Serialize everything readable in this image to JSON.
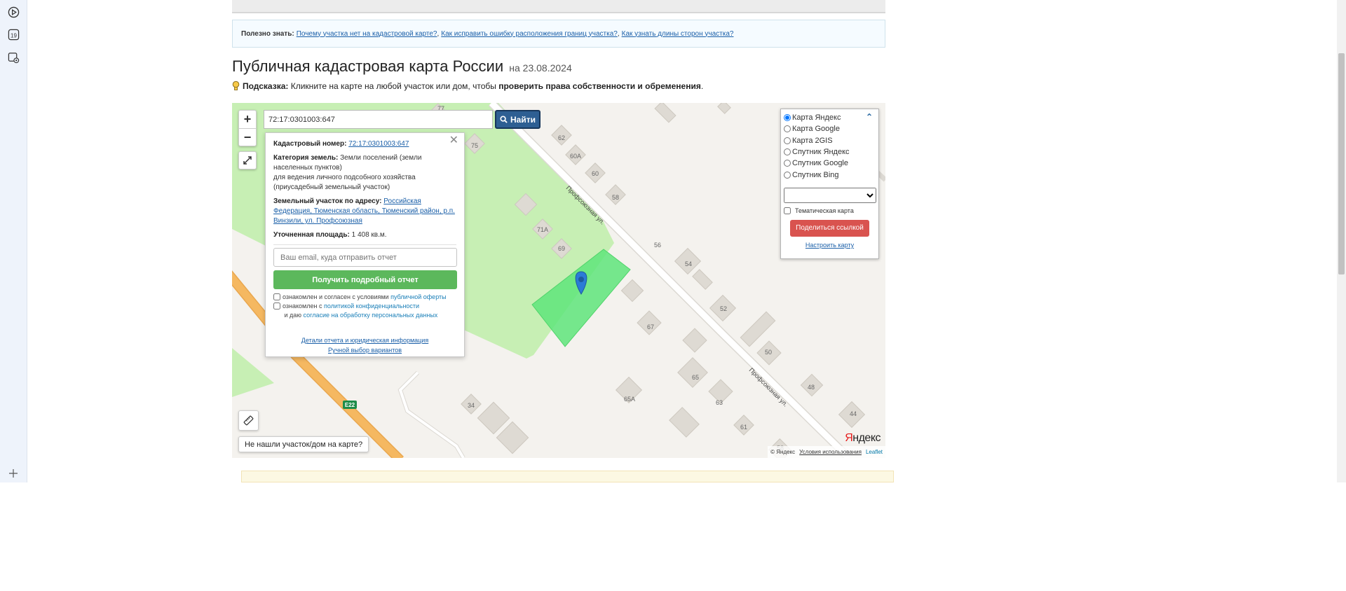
{
  "rail": {
    "icons": [
      "play-circle-icon",
      "calendar-icon",
      "screenshot-icon",
      "add-icon"
    ],
    "calendar_day": "19"
  },
  "info": {
    "lead": "Полезно знать:",
    "links": [
      "Почему участка нет на кадастровой карте?",
      "Как исправить ошибку расположения границ участка?",
      "Как узнать длины сторон участка?"
    ],
    "sep": ","
  },
  "title": {
    "main": "Публичная кадастровая карта России",
    "date": "на 23.08.2024"
  },
  "hint": {
    "label": "Подсказка:",
    "text": " Кликните на карте на любой участок или дом, чтобы ",
    "bold": "проверить права собственности и обременения",
    "end": "."
  },
  "search": {
    "value": "72:17:0301003:647",
    "button": "Найти"
  },
  "zoom": {
    "in": "+",
    "out": "−"
  },
  "popup": {
    "cadastral_label": "Кадастровый номер:",
    "cadastral_value": "72:17:0301003:647",
    "category_label": "Категория земель:",
    "category_value": "Земли поселений (земли населенных пунктов)",
    "category_use": "для ведения личного подсобного хозяйства (приусадебный земельный участок)",
    "address_label": "Земельный участок по адресу:",
    "address_value": "Российская Федерация, Тюменская область, Тюменский район, р.п. Винзили, ул. Профсоюзная",
    "area_label": "Уточненная площадь:",
    "area_value": "1 408 кв.м.",
    "email_placeholder": "Ваш email, куда отправить отчет",
    "report_button": "Получить подробный отчет",
    "consent1_text": "ознакомлен и согласен с условиями ",
    "consent1_link": "публичной оферты",
    "consent2_text": "ознакомлен с ",
    "consent2_link": "политикой конфиденциальности",
    "consent2_mid": " и даю ",
    "consent2_link2": "согласие на обработку персональных данных",
    "details_link": "Детали отчета и юридическая информация",
    "manual_link": "Ручной выбор вариантов"
  },
  "layers": {
    "options": [
      "Карта Яндекс",
      "Карта Google",
      "Карта 2GIS",
      "Спутник Яндекс",
      "Спутник Google",
      "Спутник Bing"
    ],
    "selected": "Карта Яндекс",
    "thematic": "Тематическая карта",
    "share": "Поделиться ссылкой",
    "configure": "Настроить карту"
  },
  "map": {
    "street": "Профсоюзная ул.",
    "road": "E22",
    "house_numbers": [
      "77",
      "75",
      "62",
      "60А",
      "60",
      "58",
      "71А",
      "69",
      "56",
      "54",
      "52",
      "67",
      "50",
      "65",
      "48",
      "65А",
      "63",
      "34",
      "61",
      "44",
      "58"
    ],
    "parcel_color": "#5ee57a",
    "park_color": "#c7efb4",
    "road_color": "#f5b861"
  },
  "notfound": "Не нашли участок/дом на карте?",
  "logo": {
    "y": "Я",
    "rest": "ндекс"
  },
  "attribution": {
    "copy": "© Яндекс",
    "terms": "Условия использования",
    "leaflet": "Leaflet"
  }
}
